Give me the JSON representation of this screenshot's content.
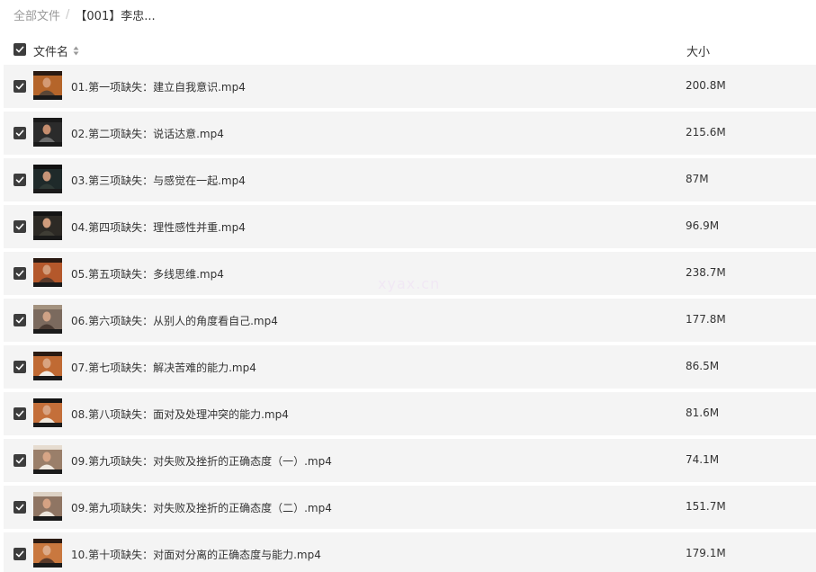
{
  "breadcrumb": {
    "root": "全部文件",
    "separator": "/",
    "current": "【001】李忠..."
  },
  "header": {
    "name_label": "文件名",
    "size_label": "大小"
  },
  "watermark": "xyax.cn",
  "files": [
    {
      "name": "01.第一项缺失：建立自我意识.mp4",
      "size": "200.8M"
    },
    {
      "name": "02.第二项缺失：说话达意.mp4",
      "size": "215.6M"
    },
    {
      "name": "03.第三项缺失：与感觉在一起.mp4",
      "size": "87M"
    },
    {
      "name": "04.第四项缺失：理性感性并重.mp4",
      "size": "96.9M"
    },
    {
      "name": "05.第五项缺失：多线思维.mp4",
      "size": "238.7M"
    },
    {
      "name": "06.第六项缺失：从别人的角度看自己.mp4",
      "size": "177.8M"
    },
    {
      "name": "07.第七项缺失：解决苦难的能力.mp4",
      "size": "86.5M"
    },
    {
      "name": "08.第八项缺失：面对及处理冲突的能力.mp4",
      "size": "81.6M"
    },
    {
      "name": "09.第九项缺失：对失败及挫折的正确态度（一）.mp4",
      "size": "74.1M"
    },
    {
      "name": "09.第九项缺失：对失败及挫折的正确态度（二）.mp4",
      "size": "151.7M"
    },
    {
      "name": "10.第十项缺失：对面对分离的正确态度与能力.mp4",
      "size": "179.1M"
    }
  ],
  "icons": {
    "checkbox": "checkbox-checked-icon",
    "sort": "sort-icon",
    "thumbnail": "video-thumbnail"
  },
  "colors": {
    "row_bg": "#f4f4f4",
    "checkbox": "#3d3d3d",
    "text": "#333333",
    "muted": "#9a9a9a"
  }
}
